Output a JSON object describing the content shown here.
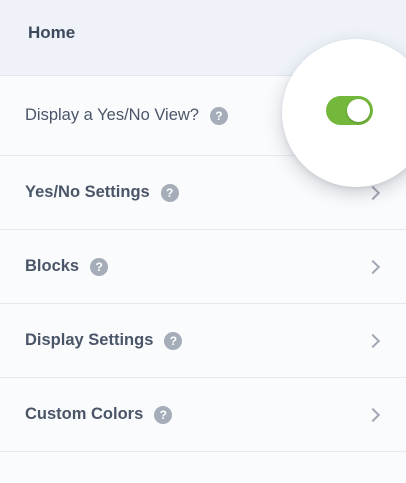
{
  "header": {
    "title": "Home"
  },
  "display_row": {
    "label": "Display a Yes/No View?",
    "help_icon": "question-mark-icon",
    "help_glyph": "?",
    "toggle_on": true,
    "toggle_color": "#73b83b"
  },
  "menu": {
    "items": [
      {
        "label": "Yes/No Settings",
        "help_glyph": "?"
      },
      {
        "label": "Blocks",
        "help_glyph": "?"
      },
      {
        "label": "Display Settings",
        "help_glyph": "?"
      },
      {
        "label": "Custom Colors",
        "help_glyph": "?"
      }
    ]
  }
}
